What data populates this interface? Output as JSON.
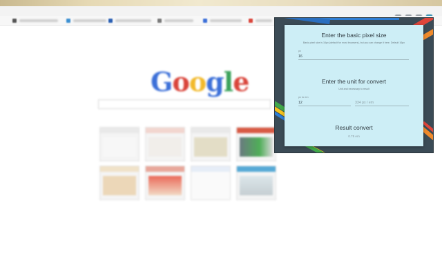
{
  "popup": {
    "base": {
      "title": "Enter the basic pixel size",
      "subtitle": "Basic pixel size is 16px (default for most browsers), but you can change it here. Default 16px",
      "label": "px",
      "value": "16"
    },
    "unit": {
      "title": "Enter the unit for convert",
      "subtitle": "Unit and necessary to result",
      "from_label": "px to em",
      "from_value": "12",
      "to_placeholder": "334 px / em"
    },
    "result": {
      "title": "Result convert",
      "value": "0.75 em"
    }
  },
  "browser": {
    "logo": [
      "G",
      "o",
      "o",
      "g",
      "l",
      "e"
    ]
  },
  "colors": {
    "popup_frame": "#3b4b56",
    "panel": "#cdeef6",
    "stripe_blue": "#2f7fd6",
    "stripe_green": "#3fa84a",
    "stripe_yellow": "#f5c21b",
    "stripe_orange": "#f08a2a",
    "stripe_red": "#e0453a",
    "extension_icon": "#3aa3c9"
  }
}
